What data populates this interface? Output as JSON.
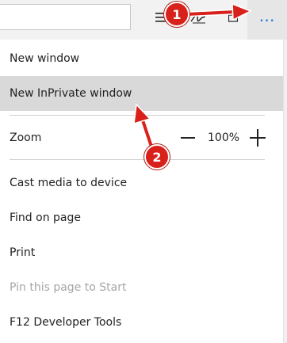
{
  "toolbar": {
    "icons": [
      "hub-icon",
      "pen-icon",
      "share-icon",
      "more-icon"
    ],
    "more_label": "⋯"
  },
  "menu": {
    "items": [
      {
        "label": "New window"
      },
      {
        "label": "New InPrivate window"
      },
      {
        "label": "Cast media to device"
      },
      {
        "label": "Find on page"
      },
      {
        "label": "Print"
      },
      {
        "label": "Pin this page to Start"
      },
      {
        "label": "F12 Developer Tools"
      }
    ],
    "zoom": {
      "label": "Zoom",
      "value": "100%"
    }
  },
  "callouts": [
    "1",
    "2"
  ],
  "colors": {
    "accent": "#1e73d0",
    "callout": "#d9211b",
    "hover_bg": "#d9d9d9",
    "disabled_text": "#a6a6a6"
  }
}
